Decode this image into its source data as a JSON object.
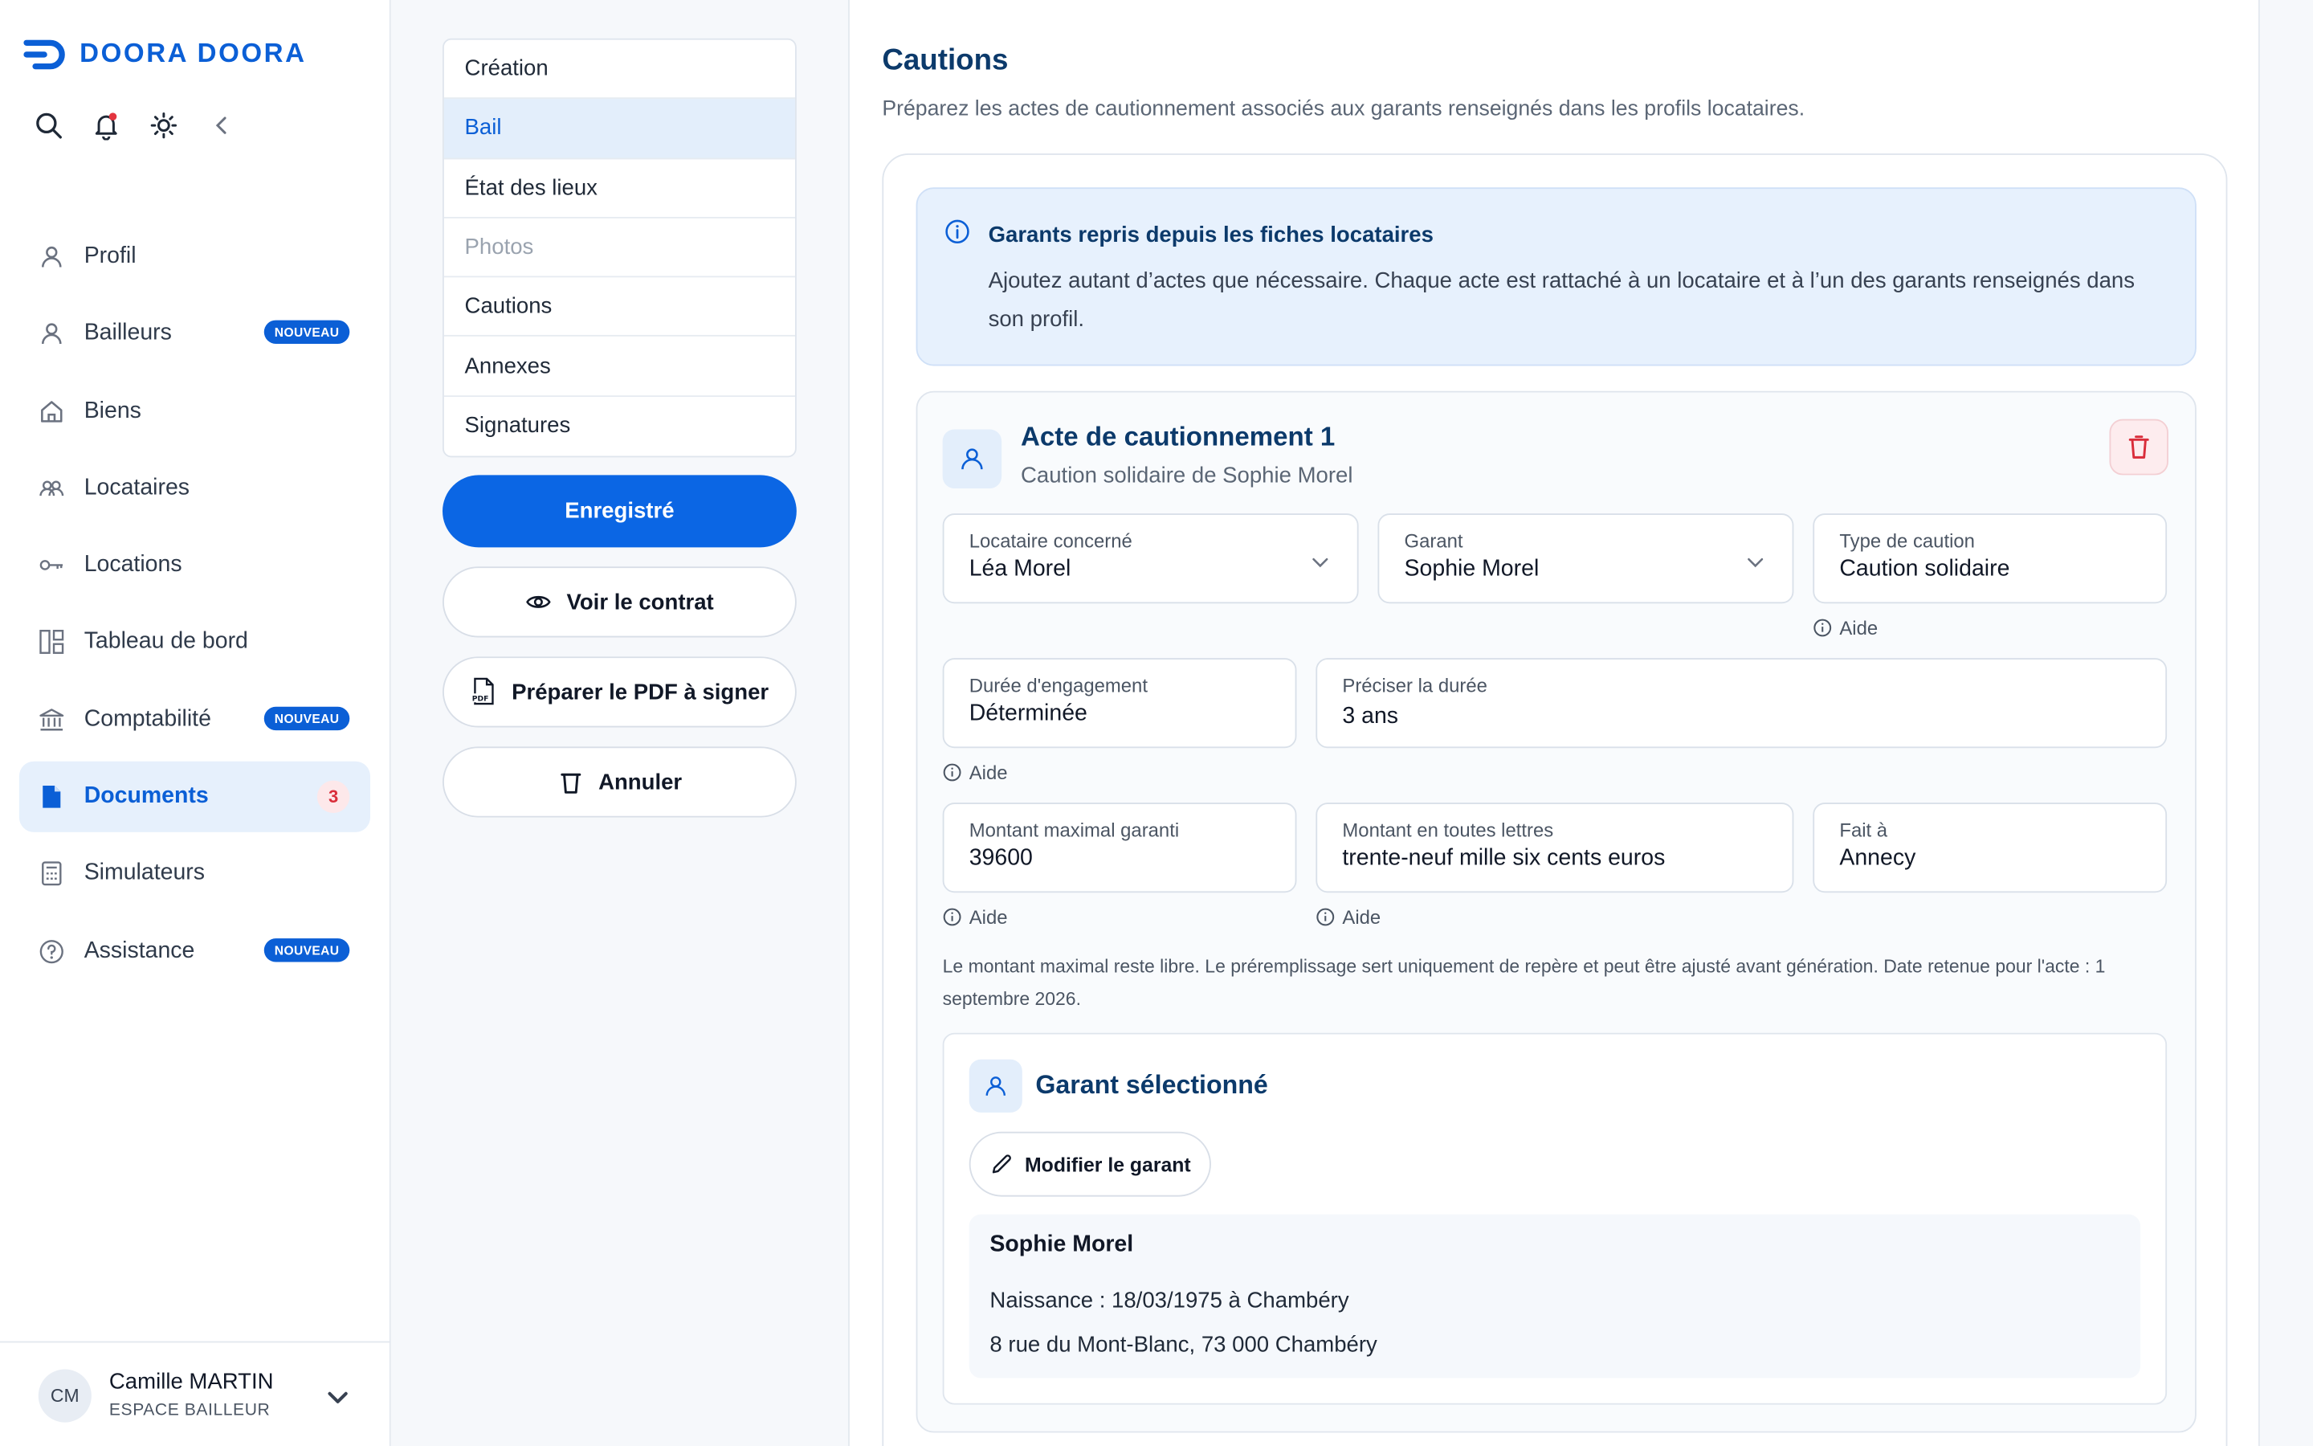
{
  "brand": {
    "name": "DOORA DOORA",
    "color": "#0b5fd6"
  },
  "toolbar": {
    "icons": [
      "search-icon",
      "bell-icon",
      "sun-icon",
      "chevron-left-icon"
    ]
  },
  "sidebar": {
    "items": [
      {
        "label": "Profil",
        "icon": "user-icon"
      },
      {
        "label": "Bailleurs",
        "icon": "user-icon",
        "badge": "NOUVEAU"
      },
      {
        "label": "Biens",
        "icon": "home-icon"
      },
      {
        "label": "Locataires",
        "icon": "users-icon"
      },
      {
        "label": "Locations",
        "icon": "key-icon"
      },
      {
        "label": "Tableau de bord",
        "icon": "dashboard-icon"
      },
      {
        "label": "Comptabilité",
        "icon": "bank-icon",
        "badge": "NOUVEAU"
      },
      {
        "label": "Documents",
        "icon": "document-icon",
        "count": "3",
        "active": true
      },
      {
        "label": "Simulateurs",
        "icon": "calculator-icon"
      },
      {
        "label": "Assistance",
        "icon": "help-icon",
        "badge": "NOUVEAU"
      }
    ]
  },
  "user": {
    "initials": "CM",
    "name": "Camille MARTIN",
    "role": "ESPACE BAILLEUR"
  },
  "steps": [
    {
      "label": "Création"
    },
    {
      "label": "Bail",
      "active": true
    },
    {
      "label": "État des lieux"
    },
    {
      "label": "Photos",
      "disabled": true
    },
    {
      "label": "Cautions"
    },
    {
      "label": "Annexes"
    },
    {
      "label": "Signatures"
    }
  ],
  "actions": {
    "saved": "Enregistré",
    "view": "Voir le contrat",
    "prepare": "Préparer le PDF à signer",
    "cancel": "Annuler"
  },
  "page": {
    "title": "Cautions",
    "subtitle": "Préparez les actes de cautionnement associés aux garants renseignés dans les profils locataires."
  },
  "info": {
    "title": "Garants repris depuis les fiches locataires",
    "text": "Ajoutez autant d’actes que nécessaire. Chaque acte est rattaché à un locataire et à l’un des garants renseignés dans son profil."
  },
  "acte": {
    "title": "Acte de cautionnement 1",
    "subtitle": "Caution solidaire de Sophie Morel",
    "fields": {
      "locataire": {
        "label": "Locataire concerné",
        "value": "Léa Morel"
      },
      "garant": {
        "label": "Garant",
        "value": "Sophie Morel"
      },
      "type": {
        "label": "Type de caution",
        "value": "Caution solidaire"
      },
      "duree": {
        "label": "Durée d'engagement",
        "value": "Déterminée"
      },
      "preciser": {
        "label": "Préciser la durée",
        "value": "3 ans"
      },
      "montant": {
        "label": "Montant maximal garanti",
        "value": "39600"
      },
      "lettres": {
        "label": "Montant en toutes lettres",
        "value": "trente-neuf mille six cents euros"
      },
      "fait": {
        "label": "Fait à",
        "value": "Annecy"
      }
    },
    "help_label": "Aide",
    "note": "Le montant maximal reste libre. Le préremplissage sert uniquement de repère et peut être ajusté avant génération. Date retenue pour l'acte : 1 septembre 2026."
  },
  "garant": {
    "title": "Garant sélectionné",
    "edit_button": "Modifier le garant",
    "name": "Sophie Morel",
    "birth": "Naissance : 18/03/1975 à Chambéry",
    "address": "8 rue du Mont-Blanc, 73 000 Chambéry"
  }
}
